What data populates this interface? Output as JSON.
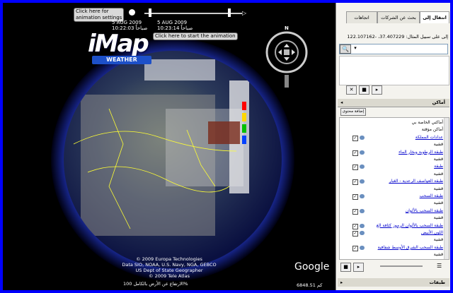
{
  "timeline": {
    "settings_callout": "Click here for\nanimation settings",
    "start_callout": "Click here to start the animation",
    "start_date": "5 AUG 2009",
    "start_time": "10:22:03 صباحاً",
    "end_date": "5 AUG 2009",
    "end_time": "10:23:14 صباحاً"
  },
  "logo": {
    "main": "iMap",
    "sub": "WEATHER"
  },
  "credits": [
    "© 2009 Europa Technologies",
    "Data SIO, NOAA, U.S. Navy, NGA, GEBCO",
    "US Dept of State Geographer",
    "© 2009 Tele Atlas"
  ],
  "status": {
    "left_text": "الارتفاع عن الأرض بالكامل",
    "zoom": "100%",
    "altitude": "6848.51 كم",
    "google": "Google"
  },
  "panel": {
    "tabs": [
      "انتقال إلى",
      "بحث عن الشركات",
      "اتجاهات"
    ],
    "search_hint": "إلى على سبيل المثال: 37.407229، -122.107162",
    "places_title": "أماكن",
    "add_content": "إضافة محتوى",
    "layers_title": "طبقات",
    "tree": [
      {
        "label": "أماكني الخاصة بي",
        "type": "text"
      },
      {
        "label": "أماكن مؤقتة",
        "type": "text"
      },
      {
        "label": "عدادات المملكة",
        "type": "link"
      },
      {
        "label": "قشية",
        "type": "text"
      },
      {
        "label": "طبقة الرطوبة وبخار الماء",
        "type": "link"
      },
      {
        "label": "قشية",
        "type": "text"
      },
      {
        "label": "طبقة",
        "type": "link"
      },
      {
        "label": "قشية",
        "type": "text"
      },
      {
        "label": "طبقة العواصف الرعدية - الغبار",
        "type": "link"
      },
      {
        "label": "قشية",
        "type": "text"
      },
      {
        "label": "طبقة السحب",
        "type": "link"
      },
      {
        "label": "قشية",
        "type": "text"
      },
      {
        "label": "طبقة السحب بالألوان",
        "type": "link"
      },
      {
        "label": "قشية",
        "type": "text"
      },
      {
        "label": "طبقة السحب بالألوان الرموز كثافة الغ",
        "type": "link"
      },
      {
        "label": "اللون الأبيض",
        "type": "link"
      },
      {
        "label": "قشية",
        "type": "text"
      },
      {
        "label": "طبقة السحب الشرق الأوسط شفافية",
        "type": "link"
      },
      {
        "label": "قشية",
        "type": "text"
      }
    ]
  },
  "nav": {
    "north": "N"
  }
}
